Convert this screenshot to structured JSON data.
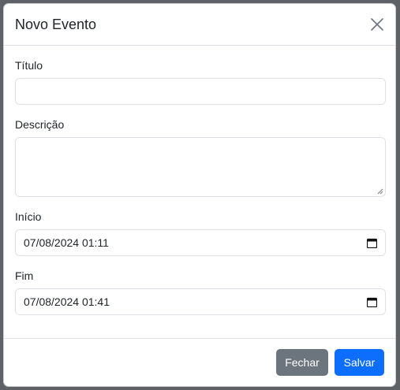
{
  "modal": {
    "title": "Novo Evento"
  },
  "form": {
    "titulo": {
      "label": "Título",
      "value": ""
    },
    "descricao": {
      "label": "Descrição",
      "value": ""
    },
    "inicio": {
      "label": "Início",
      "value": "07/08/2024 01:11"
    },
    "fim": {
      "label": "Fim",
      "value": "07/08/2024 01:41"
    }
  },
  "footer": {
    "close_label": "Fechar",
    "save_label": "Salvar"
  },
  "icons": {
    "close": "close-icon",
    "calendar": "calendar-icon",
    "resize": "resize-grip-icon"
  },
  "colors": {
    "primary": "#0d6efd",
    "secondary": "#6c757d",
    "border": "#dee2e6"
  }
}
